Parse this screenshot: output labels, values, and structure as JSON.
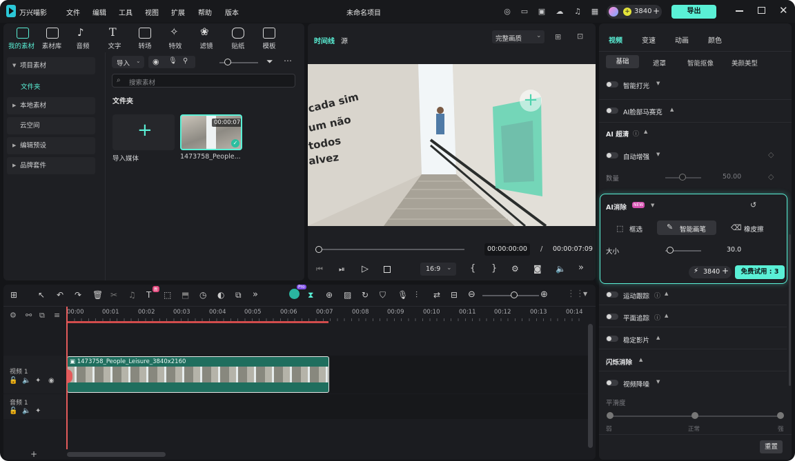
{
  "app": {
    "name": "万兴喵影",
    "project_title": "未命名项目",
    "menu": [
      "文件",
      "编辑",
      "工具",
      "视图",
      "扩展",
      "帮助",
      "版本"
    ],
    "credits": "3840",
    "export_label": "导出"
  },
  "media_tabs": [
    "我的素材",
    "素材库",
    "音频",
    "文字",
    "转场",
    "特效",
    "滤镜",
    "贴纸",
    "模板"
  ],
  "sidebar": {
    "items": [
      "项目素材",
      "文件夹",
      "本地素材",
      "云空间",
      "编辑预设",
      "品牌套件"
    ]
  },
  "media": {
    "import_label": "导入",
    "search_placeholder": "搜索素材",
    "folder_title": "文件夹",
    "import_tile_label": "导入媒体",
    "clip_name": "1473758_People...",
    "clip_duration": "00:00:07"
  },
  "player": {
    "tabs": [
      "时间线",
      "源"
    ],
    "quality": "完整画质",
    "time_current": "00:00:00:00",
    "time_sep": "/",
    "time_total": "00:00:07:09",
    "ratio": "16:9"
  },
  "timeline": {
    "ruler": [
      "00:00",
      "00:01",
      "00:02",
      "00:03",
      "00:04",
      "00:05",
      "00:06",
      "00:07",
      "00:08",
      "00:09",
      "00:10",
      "00:11",
      "00:12",
      "00:13",
      "00:14"
    ],
    "video_track": "视频 1",
    "audio_track": "音频 1",
    "clip_label": "1473758_People_Leisure_3840x2160",
    "ai_badge": "Pro",
    "new_badge": "新"
  },
  "inspector": {
    "tabs": [
      "视频",
      "变速",
      "动画",
      "颜色"
    ],
    "subtabs": [
      "基础",
      "遮罩",
      "智能抠像",
      "美颜美型"
    ],
    "smart_light": "智能打光",
    "ai_mosaic": "AI脸部马赛克",
    "ai_clear": "AI 超清",
    "auto_enhance": "自动增强",
    "amount_label": "数量",
    "amount_value": "50.00",
    "ai_remove": {
      "title": "AI消除",
      "badge": "NEW",
      "tools": [
        "框选",
        "智能画笔",
        "橡皮擦"
      ],
      "size_label": "大小",
      "size_value": "30.0",
      "credits": "3840",
      "trial": "免费试用 : 3"
    },
    "motion_track": "运动跟踪",
    "plane_track": "平面追踪",
    "stabilize": "稳定影片",
    "flicker": "闪烁消除",
    "denoise": "视频降噪",
    "smooth_label": "平滑度",
    "levels": [
      "弱",
      "正常",
      "强"
    ],
    "reset": "重置"
  },
  "colors": {
    "accent": "#5af0d6",
    "mask": "#4fd3ae",
    "playhead": "#e35b5b"
  }
}
